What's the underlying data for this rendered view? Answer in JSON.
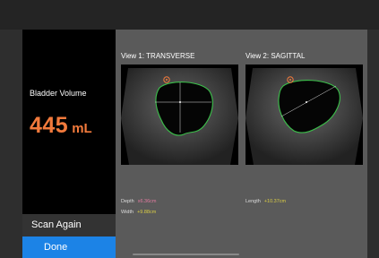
{
  "sidebar": {
    "volume_label": "Bladder Volume",
    "volume_value": "445",
    "volume_unit": "mL",
    "scan_again_label": "Scan Again",
    "done_label": "Done"
  },
  "views": [
    {
      "title": "View 1: TRANSVERSE",
      "measurements": [
        {
          "label": "Depth",
          "value": "x6.36cm"
        },
        {
          "label": "Width",
          "value": "+9.88cm"
        }
      ]
    },
    {
      "title": "View 2: SAGITTAL",
      "measurements": [
        {
          "label": "Length",
          "value": "+10.37cm"
        }
      ]
    }
  ],
  "colors": {
    "accent_volume": "#f27a3c",
    "done_button": "#1c83e6",
    "outline": "#3bbf4a",
    "depth_value": "#e27ba0",
    "width_value": "#d9cc45"
  },
  "icons": {
    "orientation_marker": "orientation-marker-icon"
  }
}
